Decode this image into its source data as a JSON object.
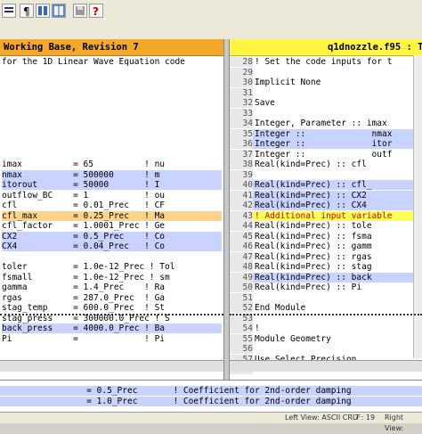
{
  "toolbar": {
    "buttons": [
      {
        "name": "compare-options-button",
        "icon": "options-icon"
      },
      {
        "name": "show-line-numbers-button",
        "icon": "paragraph-icon"
      },
      {
        "name": "show-differences-button",
        "icon": "differences-icon"
      },
      {
        "name": "layout-button",
        "icon": "grid-icon"
      },
      {
        "name": "save-button",
        "icon": "floppy-icon"
      },
      {
        "name": "help-button",
        "icon": "help-icon"
      }
    ]
  },
  "left_pane": {
    "title": "Working Base, Revision 7",
    "lines": [
      {
        "text": "for the 1D Linear Wave Equation code",
        "style": ""
      },
      {
        "text": "",
        "style": ""
      },
      {
        "text": "",
        "style": ""
      },
      {
        "text": "",
        "style": ""
      },
      {
        "text": "",
        "style": ""
      },
      {
        "text": "",
        "style": ""
      },
      {
        "text": "",
        "style": ""
      },
      {
        "text": "",
        "style": ""
      },
      {
        "text": "",
        "style": ""
      },
      {
        "text": "",
        "style": ""
      },
      {
        "text": "imax          = 65          ! nu",
        "style": ""
      },
      {
        "text": "nmax          = 500000      ! m",
        "style": "hl-blue"
      },
      {
        "text": "itorout       = 50000       ! I",
        "style": "hl-blue"
      },
      {
        "text": "outflow_BC    = 1           ! ou",
        "style": ""
      },
      {
        "text": "cfl           = 0.01_Prec   ! CF",
        "style": ""
      },
      {
        "text": "cfl_max       = 0.25_Prec   ! Ma",
        "style": "hl-orange"
      },
      {
        "text": "cfl_factor    = 1.0001_Prec ! Ge",
        "style": ""
      },
      {
        "text": "CX2           = 0.5_Prec    ! Co",
        "style": "hl-blue"
      },
      {
        "text": "CX4           = 0.04_Prec   ! Co",
        "style": "hl-blue"
      },
      {
        "text": "",
        "style": ""
      },
      {
        "text": "toler         = 1.0e-12_Prec ! Tol",
        "style": ""
      },
      {
        "text": "fsmall        = 1.0e-12_Prec ! sm",
        "style": ""
      },
      {
        "text": "gamma         = 1.4_Prec    ! Ra",
        "style": ""
      },
      {
        "text": "rgas          = 287.0_Prec  ! Ga",
        "style": ""
      },
      {
        "text": "stag_temp     = 600.0_Prec  ! St",
        "style": ""
      },
      {
        "text": "stag_press    = 300000.0_Prec ! S",
        "style": ""
      },
      {
        "text": "back_press    = 4000.0_Prec ! Ba",
        "style": "hl-blue"
      },
      {
        "text": "Pi            =             ! Pi",
        "style": ""
      }
    ]
  },
  "right_pane": {
    "title": "q1dnozzle.f95 : T",
    "lines": [
      {
        "num": "28",
        "text": "! Set the code inputs for t",
        "style": ""
      },
      {
        "num": "29",
        "text": "",
        "style": ""
      },
      {
        "num": "30",
        "text": "Implicit None",
        "style": ""
      },
      {
        "num": "31",
        "text": "",
        "style": ""
      },
      {
        "num": "32",
        "text": "Save",
        "style": ""
      },
      {
        "num": "33",
        "text": "",
        "style": ""
      },
      {
        "num": "34",
        "text": "Integer, Parameter :: imax",
        "style": ""
      },
      {
        "num": "35",
        "text": "Integer ::             nmax",
        "style": "hl-blue"
      },
      {
        "num": "36",
        "text": "Integer ::             itor",
        "style": "hl-blue"
      },
      {
        "num": "37",
        "text": "Integer ::             outf",
        "style": ""
      },
      {
        "num": "38",
        "text": "Real(kind=Prec) :: cfl",
        "style": ""
      },
      {
        "num": "39",
        "text": "",
        "style": ""
      },
      {
        "num": "40",
        "text": "Real(kind=Prec) :: cfl_",
        "style": "hl-blue"
      },
      {
        "num": "41",
        "text": "Real(kind=Prec) :: CX2",
        "style": "hl-blue"
      },
      {
        "num": "42",
        "text": "Real(kind=Prec) :: CX4",
        "style": "hl-blue"
      },
      {
        "num": "43",
        "text": "! Additional input variable",
        "style": "hl-yellow"
      },
      {
        "num": "44",
        "text": "Real(kind=Prec) :: tole",
        "style": ""
      },
      {
        "num": "45",
        "text": "Real(kind=Prec) :: fsma",
        "style": ""
      },
      {
        "num": "46",
        "text": "Real(kind=Prec) :: gamm",
        "style": ""
      },
      {
        "num": "47",
        "text": "Real(kind=Prec) :: rgas",
        "style": ""
      },
      {
        "num": "48",
        "text": "Real(kind=Prec) :: stag",
        "style": ""
      },
      {
        "num": "49",
        "text": "Real(kind=Prec) :: back",
        "style": "hl-blue"
      },
      {
        "num": "50",
        "text": "Real(kind=Prec) :: Pi",
        "style": ""
      },
      {
        "num": "51",
        "text": "",
        "style": ""
      },
      {
        "num": "52",
        "text": "End Module",
        "style": ""
      },
      {
        "num": "53",
        "text": "",
        "style": ""
      },
      {
        "num": "54",
        "text": "!",
        "style": ""
      },
      {
        "num": "55",
        "text": "Module Geometry",
        "style": ""
      },
      {
        "num": "56",
        "text": "",
        "style": ""
      },
      {
        "num": "57",
        "text": "Use Select_Precision",
        "style": ""
      },
      {
        "num": "58",
        "text": "",
        "style": ""
      }
    ]
  },
  "bottom_pane": {
    "lines": [
      {
        "text": "                 = 0.5_Prec       ! Coefficient for 2nd-order damping",
        "style": "hl-blue"
      },
      {
        "text": "                 = 1.0_Prec       ! Coefficient for 2nd-order damping",
        "style": "hl-blue"
      }
    ]
  },
  "status": {
    "left_view": "Left View: ASCII CRLF",
    "position": "7 : 19",
    "right_view": "Right View:"
  }
}
